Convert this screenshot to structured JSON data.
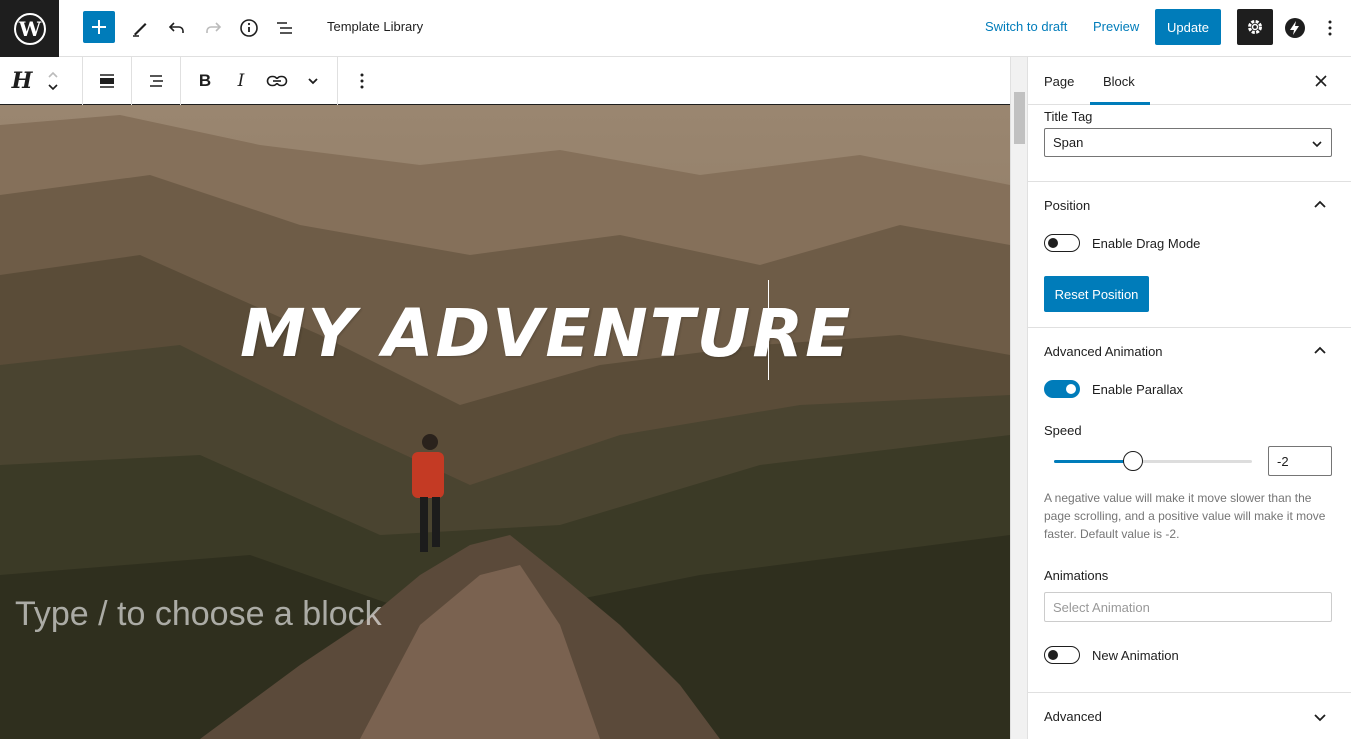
{
  "topbar": {
    "doc_title": "Template Library",
    "switch_to_draft": "Switch to draft",
    "preview": "Preview",
    "update": "Update",
    "icons": [
      "wordpress-logo",
      "plus-icon",
      "pencil-icon",
      "undo-icon",
      "redo-icon",
      "info-icon",
      "list-view-icon",
      "gear-icon",
      "jetpack-icon",
      "more-vertical-icon"
    ]
  },
  "blocktoolbar": {
    "icons": [
      "heading-block-icon",
      "move-up-icon",
      "move-down-icon",
      "align-wide-icon",
      "text-align-icon",
      "bold-icon",
      "italic-icon",
      "link-icon",
      "chevron-down-icon",
      "more-vertical-icon"
    ]
  },
  "canvas": {
    "heading": "MY ADVENTURE",
    "placeholder": "Type / to choose a block"
  },
  "sidebar": {
    "tabs": [
      "Page",
      "Block"
    ],
    "active_tab": "Block",
    "title_tag_label": "Title Tag",
    "title_tag_value": "Span",
    "position": {
      "title": "Position",
      "drag_mode_label": "Enable Drag Mode",
      "drag_mode_on": false,
      "reset_label": "Reset Position"
    },
    "advanced_animation": {
      "title": "Advanced Animation",
      "parallax_label": "Enable Parallax",
      "parallax_on": true,
      "speed_label": "Speed",
      "speed_value": "-2",
      "speed_fraction": 0.4,
      "help": "A negative value will make it move slower than the page scrolling, and a positive value will make it move faster. Default value is -2.",
      "animations_label": "Animations",
      "animation_placeholder": "Select Animation",
      "new_animation_label": "New Animation",
      "new_animation_on": false
    },
    "advanced_title": "Advanced"
  },
  "colors": {
    "accent": "#007cba",
    "dark": "#1e1e1e"
  }
}
